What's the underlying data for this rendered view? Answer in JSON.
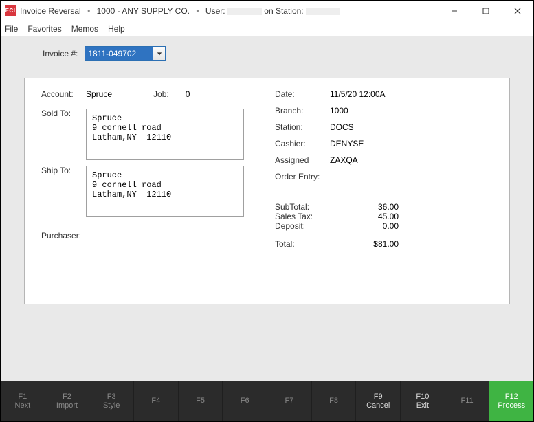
{
  "app_icon_text": "ECI",
  "title": {
    "app": "Invoice Reversal",
    "company": "1000 - ANY SUPPLY CO.",
    "user_label": "User:",
    "station_label": "on Station:"
  },
  "menu": {
    "file": "File",
    "favorites": "Favorites",
    "memos": "Memos",
    "help": "Help"
  },
  "invoice": {
    "label": "Invoice #:",
    "value": "1811-049702"
  },
  "account": {
    "label": "Account:",
    "value": "Spruce"
  },
  "job": {
    "label": "Job:",
    "value": "0"
  },
  "sold_to": {
    "label": "Sold To:",
    "text": "Spruce\n9 cornell road\nLatham,NY  12110"
  },
  "ship_to": {
    "label": "Ship To:",
    "text": "Spruce\n9 cornell road\nLatham,NY  12110"
  },
  "purchaser": {
    "label": "Purchaser:"
  },
  "meta": {
    "date_label": "Date:",
    "date_value": "11/5/20    12:00A",
    "branch_label": "Branch:",
    "branch_value": "1000",
    "station_label": "Station:",
    "station_value": "DOCS",
    "cashier_label": "Cashier:",
    "cashier_value": "DENYSE",
    "assigned_label": "Assigned",
    "assigned_value": "ZAXQA",
    "order_entry_label": "Order Entry:"
  },
  "totals": {
    "subtotal_label": "SubTotal:",
    "subtotal_value": "36.00",
    "tax_label": "Sales Tax:",
    "tax_value": "45.00",
    "deposit_label": "Deposit:",
    "deposit_value": "0.00",
    "total_label": "Total:",
    "total_value": "$81.00"
  },
  "fkeys": [
    {
      "num": "F1",
      "label": "Next"
    },
    {
      "num": "F2",
      "label": "Import"
    },
    {
      "num": "F3",
      "label": "Style"
    },
    {
      "num": "F4",
      "label": ""
    },
    {
      "num": "F5",
      "label": ""
    },
    {
      "num": "F6",
      "label": ""
    },
    {
      "num": "F7",
      "label": ""
    },
    {
      "num": "F8",
      "label": ""
    },
    {
      "num": "F9",
      "label": "Cancel"
    },
    {
      "num": "F10",
      "label": "Exit"
    },
    {
      "num": "F11",
      "label": ""
    },
    {
      "num": "F12",
      "label": "Process"
    }
  ]
}
